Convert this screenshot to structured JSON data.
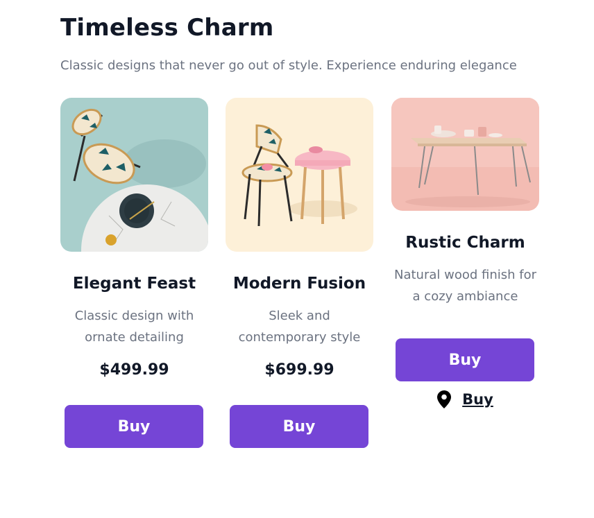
{
  "header": {
    "title": "Timeless Charm",
    "subtitle": "Classic designs that never go out of style. Experience enduring elegance"
  },
  "products": [
    {
      "name": "Elegant Feast",
      "desc_line1": "Classic design with",
      "desc_line2": "ornate detailing",
      "price": "$499.99",
      "button_label": "Buy",
      "image_icon": "chair-and-marble-table-photo"
    },
    {
      "name": "Modern Fusion",
      "desc_line1": "Sleek and",
      "desc_line2": "contemporary style",
      "price": "$699.99",
      "button_label": "Buy",
      "image_icon": "chair-and-pink-side-table-photo"
    },
    {
      "name": "Rustic Charm",
      "desc_line1": "Natural wood finish for",
      "desc_line2": "a cozy ambiance",
      "button_label": "Buy",
      "link_label": "Buy",
      "link_icon": "map-pin-icon",
      "image_icon": "pink-wooden-table-photo"
    }
  ],
  "colors": {
    "accent": "#7545d6",
    "heading": "#111827",
    "muted": "#6b7280"
  }
}
